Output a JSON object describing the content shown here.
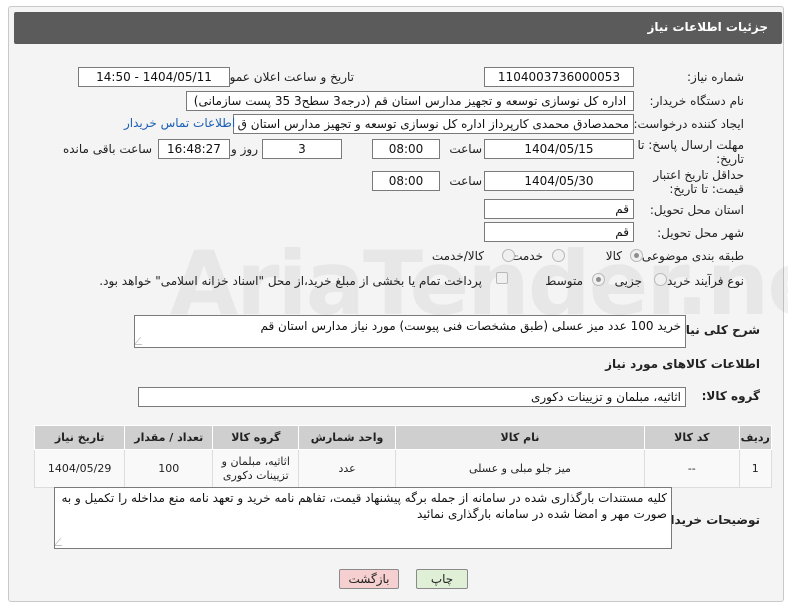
{
  "header": {
    "title": "جزئیات اطلاعات نیاز"
  },
  "fields": {
    "need_number_label": "شماره نیاز:",
    "need_number": "1104003736000053",
    "announce_label": "تاریخ و ساعت اعلان عمومی:",
    "announce_value": "1404/05/11 - 14:50",
    "buyer_org_label": "نام دستگاه خریدار:",
    "buyer_org": "اداره کل نوسازی   توسعه و تجهیز مدارس استان قم (درجه3 سطح3  35 پست سازمانی)",
    "creator_label": "ایجاد کننده درخواست:",
    "creator": "محمدصادق محمدی کارپرداز  اداره کل نوسازی   توسعه و تجهیز مدارس استان ق",
    "contact_link": "اطلاعات تماس خریدار",
    "deadline_label": "مهلت ارسال پاسخ: تا تاریخ:",
    "deadline_date": "1404/05/15",
    "time_label": "ساعت",
    "deadline_time": "08:00",
    "days_value": "3",
    "days_label": "روز و",
    "remaining_time": "16:48:27",
    "remaining_label": "ساعت باقی مانده",
    "price_valid_label": "حداقل تاریخ اعتبار قیمت: تا تاریخ:",
    "price_valid_date": "1404/05/30",
    "price_valid_time": "08:00",
    "province_label": "استان محل تحویل:",
    "province": "قم",
    "city_label": "شهر محل تحویل:",
    "city": "قم",
    "category_label": "طبقه بندی موضوعی:",
    "category_options": [
      "کالا",
      "خدمت",
      "کالا/خدمت"
    ],
    "process_label": "نوع فرآیند خرید :",
    "process_options": [
      "جزیی",
      "متوسط"
    ],
    "payment_note": "پرداخت تمام یا بخشی از مبلغ خرید،از محل \"اسناد خزانه اسلامی\" خواهد بود."
  },
  "description": {
    "label": "شرح کلی نیاز:",
    "text": "خرید 100 عدد میز عسلی (طبق مشخصات فنی پیوست) مورد نیاز مدارس استان قم"
  },
  "goods": {
    "section_title": "اطلاعات کالاهای مورد نیاز",
    "group_label": "گروه کالا:",
    "group_value": "اثاثیه، مبلمان و تزیینات دکوری",
    "columns": [
      "ردیف",
      "کد کالا",
      "نام کالا",
      "واحد شمارش",
      "گروه کالا",
      "تعداد / مقدار",
      "تاریخ نیاز"
    ],
    "rows": [
      [
        "1",
        "--",
        "میز جلو مبلی و عسلی",
        "عدد",
        "اثاثیه، مبلمان و تزیینات دکوری",
        "100",
        "1404/05/29"
      ]
    ]
  },
  "buyer_notes": {
    "label": "توضیحات خریدار:",
    "text": "کلیه مستندات بارگذاری شده در سامانه از جمله برگه پیشنهاد قیمت، تفاهم نامه خرید و تعهد نامه منع مداخله را تکمیل و به صورت مهر و امضا شده در سامانه بارگذاری نمائید"
  },
  "buttons": {
    "print": "چاپ",
    "back": "بازگشت"
  },
  "watermark": "AriaTender.neT",
  "colors": {
    "header_bg": "#5b5b5b",
    "link": "#1a5fb4",
    "back_btn": "#f6d0d0",
    "print_btn": "#e0f0d6"
  }
}
